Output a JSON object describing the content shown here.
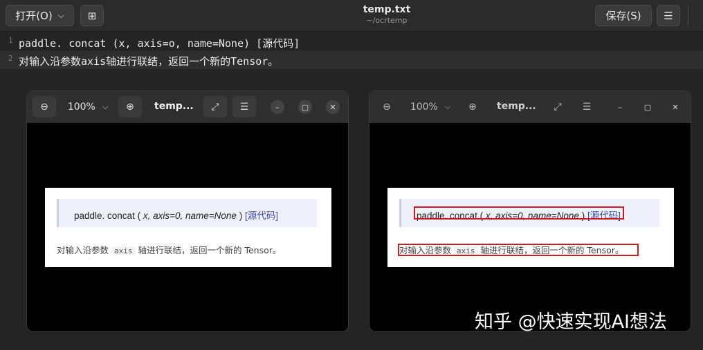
{
  "editor": {
    "open_label": "打开(O)",
    "open_chevron": "⌵",
    "new_tab_icon": "⊞",
    "title": "temp.txt",
    "subtitle": "~/ocrtemp",
    "save_label": "保存(S)",
    "menu_icon": "☰",
    "lines": [
      {
        "num": "1",
        "text": "paddle. concat (x, axis=o, name=None) [源代码]"
      },
      {
        "num": "2",
        "text": "对输入沿参数axis轴进行联结，返回一个新的Tensor。"
      }
    ]
  },
  "viewers": [
    {
      "zoom_out_icon": "⊖",
      "zoom_value": "100%",
      "zoom_chevron": "⌵",
      "zoom_in_icon": "⊕",
      "title": "temp...",
      "expand_icon": "⤢",
      "menu_icon": "☰",
      "minimize_icon": "–",
      "maximize_icon": "▢",
      "close_icon": "✕"
    },
    {
      "zoom_out_icon": "⊖",
      "zoom_value": "100%",
      "zoom_chevron": "⌵",
      "zoom_in_icon": "⊕",
      "title": "temp...",
      "expand_icon": "⤢",
      "menu_icon": "☰",
      "minimize_icon": "–",
      "maximize_icon": "▢",
      "close_icon": "✕"
    }
  ],
  "doc": {
    "sig_name": "paddle. concat (",
    "sig_params": "x, axis=0, name=None",
    "sig_close": ")",
    "sig_source": "[源代码]",
    "desc_before": "对输入沿参数",
    "desc_code": "axis",
    "desc_after": "轴进行联结，返回一个新的 Tensor。"
  },
  "watermark": "知乎 @快速实现AI想法",
  "colors": {
    "ocr_box": "#d11a1a",
    "source_link": "#3b4ba7",
    "signature_bg": "#eef0fb"
  }
}
